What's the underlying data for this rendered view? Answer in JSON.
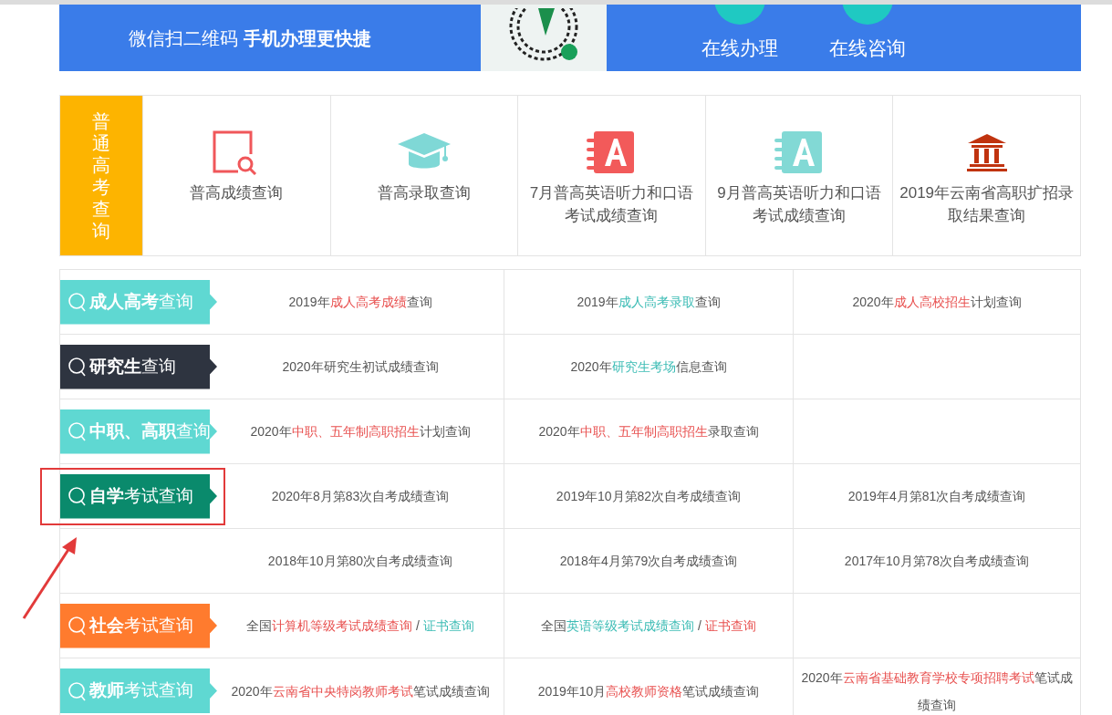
{
  "banner": {
    "slogan": "微信扫二维码 **手机办理更快捷**",
    "actions": [
      {
        "label": "在线办理"
      },
      {
        "label": "在线咨询"
      }
    ]
  },
  "gaokao": {
    "label": "普通高考查询",
    "items": [
      {
        "label": "普高成绩查询",
        "kind": "magnifier",
        "color": "#f0575a"
      },
      {
        "label": "普高录取查询",
        "kind": "cap",
        "color": "#7fd8d6"
      },
      {
        "label": "7月普高英语听力和口语考试成绩查询",
        "kind": "notebook",
        "color": "#f25a5a"
      },
      {
        "label": "9月普高英语听力和口语考试成绩查询",
        "kind": "notebook",
        "color": "#82d9d5"
      },
      {
        "label": "2019年云南省高职扩招录取结果查询",
        "kind": "building",
        "color": "#c0330f"
      }
    ]
  },
  "rows": [
    {
      "tag": {
        "label": "**成人高考**查询",
        "color": "#5fd8d2"
      },
      "highlighted": false,
      "cells": [
        {
          "parts": [
            {
              "text": "2019年"
            },
            {
              "text": "成人高考成绩",
              "color": "#e8504f"
            },
            {
              "text": "查询"
            }
          ]
        },
        {
          "parts": [
            {
              "text": "2019年"
            },
            {
              "text": "成人高考录取",
              "color": "#3cbcb5"
            },
            {
              "text": "查询"
            }
          ]
        },
        {
          "parts": [
            {
              "text": "2020年"
            },
            {
              "text": "成人高校招生",
              "color": "#e8504f"
            },
            {
              "text": "计划查询"
            }
          ]
        }
      ]
    },
    {
      "tag": {
        "label": "**研究生**查询",
        "color": "#2e3440"
      },
      "highlighted": false,
      "cells": [
        {
          "parts": [
            {
              "text": "2020年研究生初试成绩查询"
            }
          ]
        },
        {
          "parts": [
            {
              "text": "2020年"
            },
            {
              "text": "研究生考场",
              "color": "#3cbcb5"
            },
            {
              "text": "信息查询"
            }
          ]
        }
      ]
    },
    {
      "tag": {
        "label": "**中职、高职**查询",
        "color": "#5fd8d2"
      },
      "highlighted": false,
      "cells": [
        {
          "parts": [
            {
              "text": "2020年"
            },
            {
              "text": "中职、五年制高职招生",
              "color": "#e8504f"
            },
            {
              "text": "计划查询"
            }
          ]
        },
        {
          "parts": [
            {
              "text": "2020年"
            },
            {
              "text": "中职、五年制高职招生",
              "color": "#e8504f"
            },
            {
              "text": "录取查询"
            }
          ]
        }
      ]
    },
    {
      "tag": {
        "label": "**自学**考试查询",
        "color": "#0a8a6c"
      },
      "highlighted": true,
      "cells": [
        {
          "parts": [
            {
              "text": "2020年8月第83次自考成绩查询"
            }
          ]
        },
        {
          "parts": [
            {
              "text": "2019年10月第82次自考成绩查询"
            }
          ]
        },
        {
          "parts": [
            {
              "text": "2019年4月第81次自考成绩查询"
            }
          ]
        }
      ]
    },
    {
      "highlighted": false,
      "cells": [
        {
          "parts": [
            {
              "text": "2018年10月第80次自考成绩查询"
            }
          ]
        },
        {
          "parts": [
            {
              "text": "2018年4月第79次自考成绩查询"
            }
          ]
        },
        {
          "parts": [
            {
              "text": "2017年10月第78次自考成绩查询"
            }
          ]
        }
      ]
    },
    {
      "tag": {
        "label": "**社会**考试查询",
        "color": "#ff7b2e"
      },
      "highlighted": false,
      "cells": [
        {
          "parts": [
            {
              "text": "全国"
            },
            {
              "text": "计算机等级考试成绩查询",
              "color": "#e8504f"
            },
            {
              "text": " / "
            },
            {
              "text": "证书查询",
              "color": "#3cbcb5"
            }
          ]
        },
        {
          "parts": [
            {
              "text": "全国"
            },
            {
              "text": "英语等级考试成绩查询",
              "color": "#3cbcb5"
            },
            {
              "text": " / "
            },
            {
              "text": "证书查询",
              "color": "#e8504f"
            }
          ]
        }
      ]
    },
    {
      "tag": {
        "label": "**教师**考试查询",
        "color": "#5fd8d2"
      },
      "highlighted": false,
      "cells": [
        {
          "parts": [
            {
              "text": "2020年"
            },
            {
              "text": "云南省中央特岗教师考试",
              "color": "#e8504f"
            },
            {
              "text": "笔试成绩查询"
            }
          ]
        },
        {
          "parts": [
            {
              "text": "2019年10月"
            },
            {
              "text": "高校教师资格",
              "color": "#e8504f"
            },
            {
              "text": "笔试成绩查询"
            }
          ]
        },
        {
          "parts": [
            {
              "text": "2020年"
            },
            {
              "text": "云南省基础教育学校专项招聘考试",
              "color": "#e8504f"
            },
            {
              "text": "笔试成绩查询"
            }
          ]
        }
      ]
    }
  ]
}
